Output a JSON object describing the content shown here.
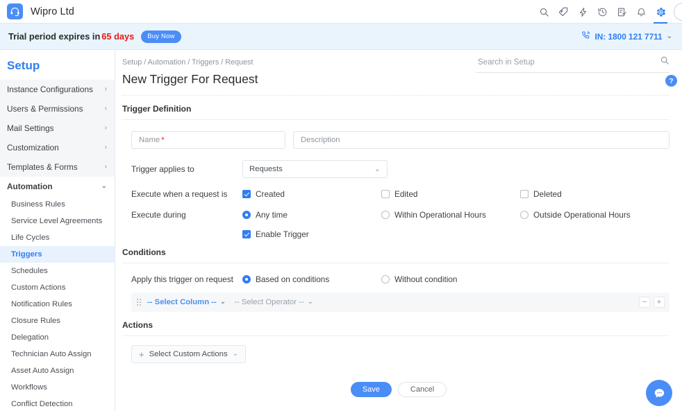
{
  "topbar": {
    "logo_icon": "headset-icon",
    "app_title": "Wipro Ltd",
    "icons": [
      {
        "name": "search-icon"
      },
      {
        "name": "add-request-icon"
      },
      {
        "name": "quick-actions-bolt-icon"
      },
      {
        "name": "recent-history-icon"
      },
      {
        "name": "tasks-icon"
      },
      {
        "name": "notifications-bell-icon"
      },
      {
        "name": "settings-gear-icon"
      }
    ]
  },
  "trial": {
    "prefix": "Trial period expires in",
    "days": "65 days",
    "buy_now": "Buy Now",
    "phone": "IN: 1800 121 7711",
    "phone_icon": "phone-ring-icon",
    "chevron": "⌄"
  },
  "sidebar": {
    "title": "Setup",
    "top_items": [
      {
        "label": "Instance Configurations",
        "expanded": false
      },
      {
        "label": "Users & Permissions",
        "expanded": false
      },
      {
        "label": "Mail Settings",
        "expanded": false
      },
      {
        "label": "Customization",
        "expanded": false
      },
      {
        "label": "Templates & Forms",
        "expanded": false
      },
      {
        "label": "Automation",
        "expanded": true
      }
    ],
    "sub_items": [
      {
        "label": "Business Rules",
        "active": false
      },
      {
        "label": "Service Level Agreements",
        "active": false
      },
      {
        "label": "Life Cycles",
        "active": false
      },
      {
        "label": "Triggers",
        "active": true
      },
      {
        "label": "Schedules",
        "active": false
      },
      {
        "label": "Custom Actions",
        "active": false
      },
      {
        "label": "Notification Rules",
        "active": false
      },
      {
        "label": "Closure Rules",
        "active": false
      },
      {
        "label": "Delegation",
        "active": false
      },
      {
        "label": "Technician Auto Assign",
        "active": false
      },
      {
        "label": "Asset Auto Assign",
        "active": false
      },
      {
        "label": "Workflows",
        "active": false
      },
      {
        "label": "Conflict Detection",
        "active": false
      }
    ],
    "chevron_right": "›",
    "chevron_down": "⌄"
  },
  "main": {
    "breadcrumb": "Setup / Automation / Triggers / Request",
    "page_title": "New Trigger For Request",
    "search_placeholder": "Search in Setup",
    "search_value": "",
    "search_icon": "search-icon",
    "help_label": "?"
  },
  "trigger_definition": {
    "section_title": "Trigger Definition",
    "name_placeholder": "Name",
    "name_value": "",
    "name_required_mark": "*",
    "description_placeholder": "Description",
    "description_value": "",
    "applies_to_label": "Trigger applies to",
    "applies_to_value": "Requests",
    "execute_when_label": "Execute when a request is",
    "execute_when_options": [
      {
        "label": "Created",
        "checked": true
      },
      {
        "label": "Edited",
        "checked": false
      },
      {
        "label": "Deleted",
        "checked": false
      }
    ],
    "execute_during_label": "Execute during",
    "execute_during_options": [
      {
        "label": "Any time",
        "selected": true
      },
      {
        "label": "Within Operational Hours",
        "selected": false
      },
      {
        "label": "Outside Operational Hours",
        "selected": false
      }
    ],
    "enable_trigger_label": "Enable Trigger",
    "enable_trigger_checked": true
  },
  "conditions": {
    "section_title": "Conditions",
    "apply_label": "Apply this trigger on request",
    "apply_options": [
      {
        "label": "Based on conditions",
        "selected": true
      },
      {
        "label": "Without condition",
        "selected": false
      }
    ],
    "row": {
      "drag_handle_icon": "drag-handle-icon",
      "column_value": "-- Select Column --",
      "operator_value": "-- Select Operator --",
      "remove_label": "−",
      "add_label": "+"
    }
  },
  "actions": {
    "section_title": "Actions",
    "select_custom_actions_label": "Select Custom Actions",
    "plus_icon": "plus-icon",
    "chevron": "⌄"
  },
  "footer": {
    "save_label": "Save",
    "cancel_label": "Cancel"
  },
  "chat": {
    "icon": "chat-bubble-icon"
  },
  "colors": {
    "accent_blue": "#2f7ef0",
    "button_blue": "#4a8df6",
    "banner_blue": "#e9f4fc",
    "required_red": "#e5332a",
    "trial_red": "#f01414"
  }
}
